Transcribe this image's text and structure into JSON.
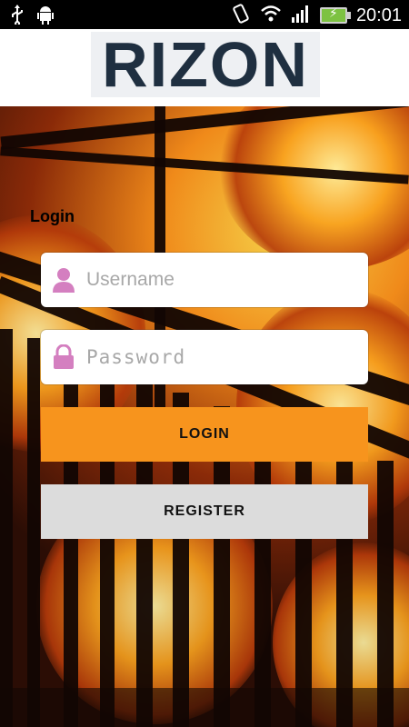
{
  "status_bar": {
    "time": "20:01",
    "icons": [
      "usb-icon",
      "android-debug-icon",
      "vibrate-icon",
      "wifi-icon",
      "signal-icon",
      "battery-charging-icon"
    ]
  },
  "header": {
    "logo_text": "RIZON"
  },
  "form": {
    "title": "Login",
    "username": {
      "placeholder": "Username",
      "value": ""
    },
    "password": {
      "placeholder": "Password",
      "value": ""
    }
  },
  "buttons": {
    "login_label": "LOGIN",
    "register_label": "REGISTER"
  },
  "colors": {
    "accent": "#f7941d",
    "secondary_button": "#dcdcdc",
    "icon_tint": "#d47fc0",
    "logo": "#1f2f40"
  }
}
